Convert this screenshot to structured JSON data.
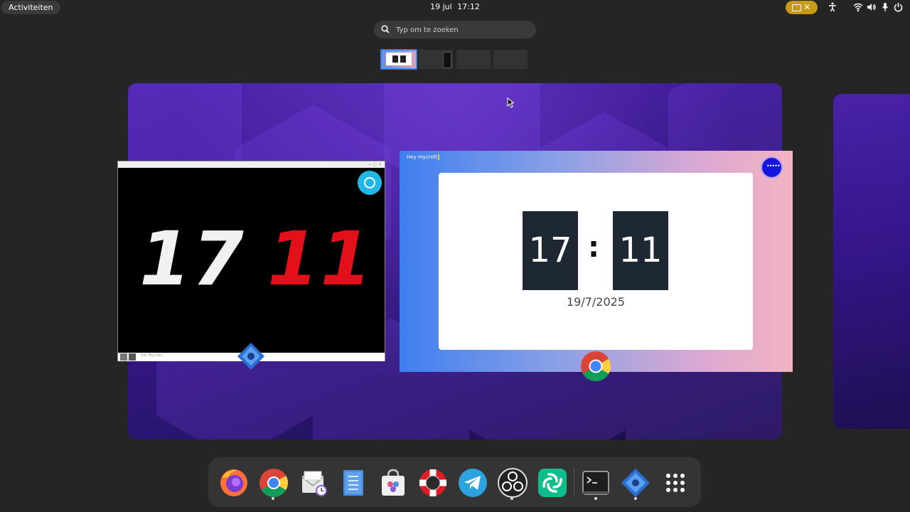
{
  "topbar": {
    "activities_label": "Activiteiten",
    "date": "19 jul",
    "time": "17:12",
    "tray_icons": [
      "screen-share-icon",
      "close-icon",
      "accessibility-icon",
      "wifi-icon",
      "volume-icon",
      "microphone-icon",
      "power-icon"
    ]
  },
  "search": {
    "placeholder": "Typ om te zoeken"
  },
  "workspaces": {
    "count": 4,
    "active_index": 0
  },
  "windows": {
    "mycroft": {
      "hour": "17",
      "minute": "11",
      "ask_placeholder": "Ask Mycroft..."
    },
    "chrome": {
      "hey_text": "Hey mycroft",
      "menu_dots": "•••••",
      "hour": "17",
      "colon": ":",
      "minute": "11",
      "date": "19/7/2025"
    }
  },
  "dash": {
    "items": [
      "firefox-icon",
      "chrome-icon",
      "mail-icon",
      "files-icon",
      "software-icon",
      "help-icon",
      "telegram-icon",
      "obs-icon",
      "element-icon",
      "terminal-icon",
      "mycroft-icon",
      "app-grid-icon"
    ]
  },
  "colors": {
    "accent": "#3584e4",
    "indicator": "#c89b16",
    "mycroft_minute": "#e3101a"
  }
}
